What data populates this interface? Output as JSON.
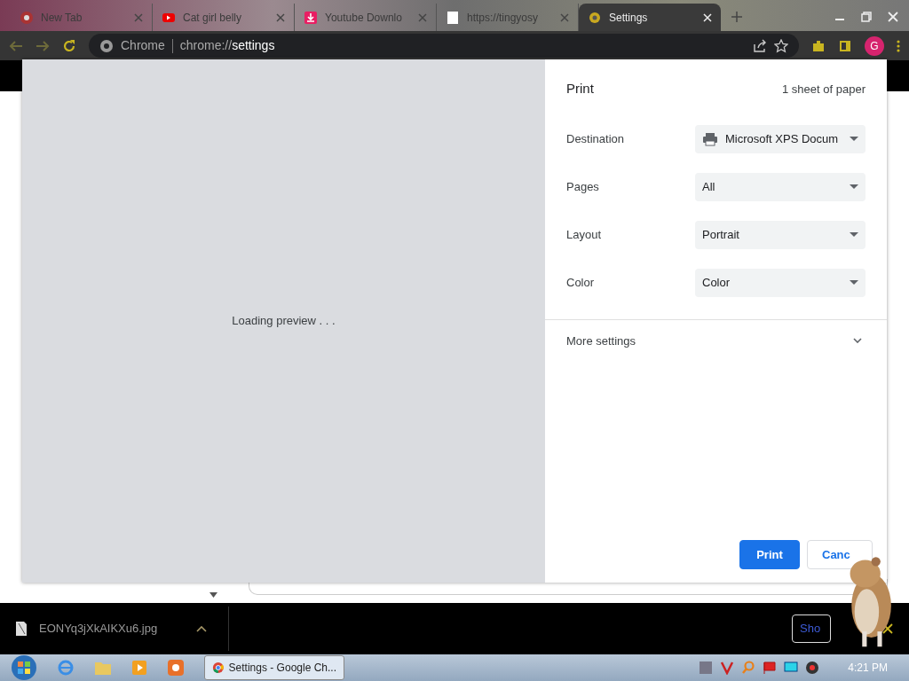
{
  "browser": {
    "tabs": [
      {
        "title": "New Tab",
        "kind": "chrome",
        "selected": false
      },
      {
        "title": "Cat girl belly",
        "kind": "youtube",
        "selected": false
      },
      {
        "title": "Youtube Downlo",
        "kind": "download",
        "selected": false
      },
      {
        "title": "https://tingyosy",
        "kind": "page",
        "selected": false
      },
      {
        "title": "Settings",
        "kind": "settings",
        "selected": true
      }
    ],
    "address": {
      "origin": "Chrome",
      "url_prefix": "chrome://",
      "url_path": "settings"
    },
    "profile_initial": "G"
  },
  "print_dialog": {
    "title": "Print",
    "sheets": "1 sheet of paper",
    "preview_status": "Loading preview . . .",
    "settings": [
      {
        "label": "Destination",
        "value": "Microsoft XPS Docum",
        "kind": "printer"
      },
      {
        "label": "Pages",
        "value": "All",
        "kind": "select"
      },
      {
        "label": "Layout",
        "value": "Portrait",
        "kind": "select"
      },
      {
        "label": "Color",
        "value": "Color",
        "kind": "select"
      }
    ],
    "more_settings": {
      "label": "More settings",
      "expanded": false
    },
    "buttons": [
      {
        "label": "Print",
        "kind": "primary"
      },
      {
        "label": "Canc",
        "kind": "secondary"
      }
    ]
  },
  "download_bar": {
    "file": "EONYq3jXkAIKXu6.jpg",
    "show_all": "Sho"
  },
  "taskbar": {
    "active_window": "Settings - Google Ch...",
    "clock": "4:21 PM"
  }
}
